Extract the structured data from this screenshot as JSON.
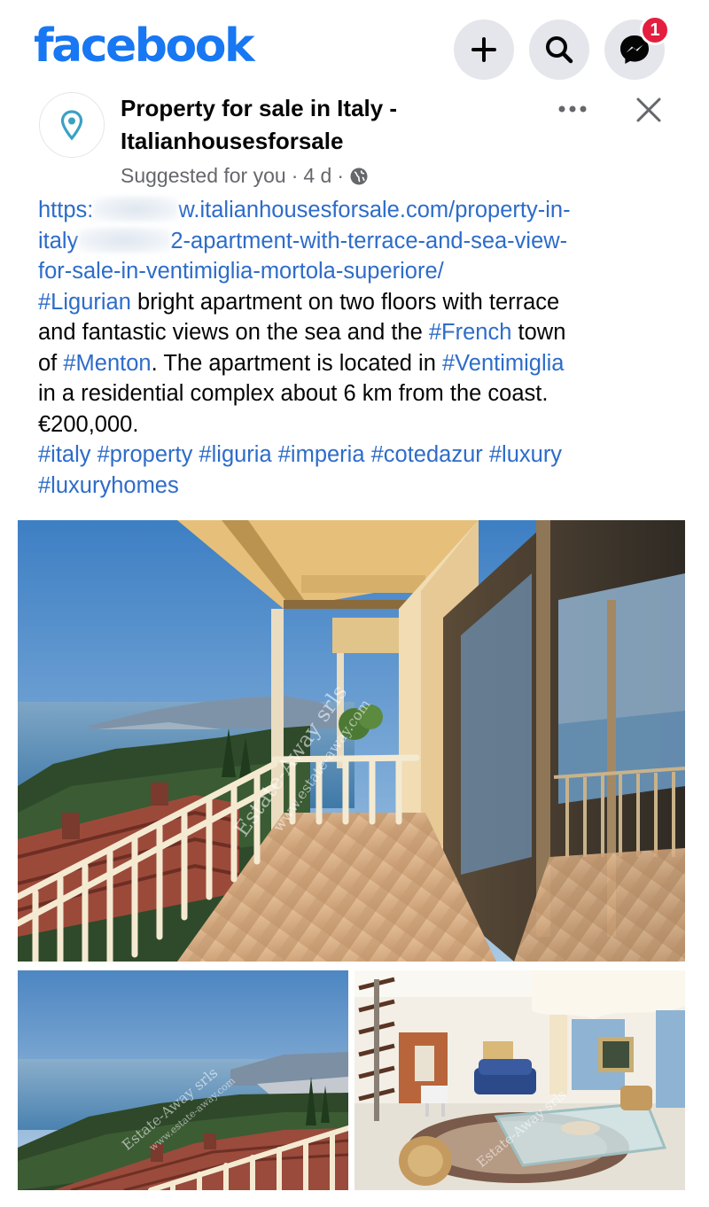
{
  "header": {
    "logo": "facebook",
    "notification_count": "1",
    "icons": [
      "plus-icon",
      "search-icon",
      "messenger-icon"
    ]
  },
  "post": {
    "page_name_line1": "Property for sale in Italy -",
    "page_name_line2": "Italianhousesforsale",
    "suggested": "Suggested for you",
    "age": "4 d",
    "audience_icon": "globe-icon",
    "link_line1_start": "https:",
    "link_line1_end": "w.italianhousesforsale.com/property-in-",
    "link_line2_start": "italy",
    "link_line2_end": "2-apartment-with-terrace-and-sea-view-",
    "link_line3": "for-sale-in-ventimiglia-mortola-superiore/",
    "tag_ligurian": "#Ligurian",
    "text_a": " bright apartment on two floors with terrace",
    "text_b": "and fantastic views on the sea and the ",
    "tag_french": "#French",
    "text_c": " town",
    "text_d": "of ",
    "tag_menton": "#Menton",
    "text_e": ". The apartment is located in ",
    "tag_ventimiglia": "#Ventimiglia",
    "text_f": "in a residential complex about 6 km from the coast.",
    "price": "€200,000.",
    "tags_line1": "#italy #property #liguria #imperia #cotedazur #luxury",
    "tags_line2": "#luxuryhomes"
  },
  "photos": {
    "watermark_main": "Estate-Away srls",
    "watermark_main_sub": "www.estate-away.com",
    "watermark_small": "Estate-Away srls",
    "watermark_small_sub": "www.estate-away.com"
  },
  "colors": {
    "brand": "#1877f2",
    "link": "#2d6cc9",
    "badge": "#e41e3f",
    "muted": "#65676b"
  }
}
